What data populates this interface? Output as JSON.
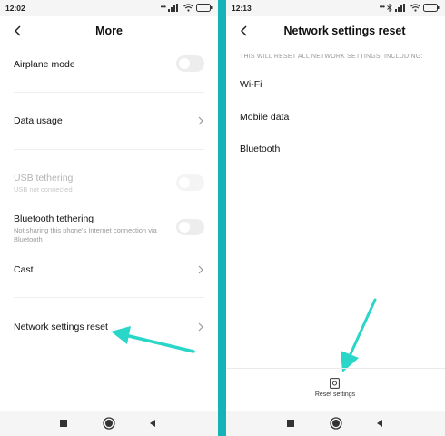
{
  "colors": {
    "accent_arrow": "#2ad6c8",
    "divider": "#14b3b8",
    "disabled_text": "#b5b5b5",
    "secondary_text": "#999999"
  },
  "left": {
    "status_bar": {
      "time": "12:02",
      "icons": [
        "signal-dots-icon",
        "cell-signal-icon",
        "wifi-icon",
        "battery-icon"
      ]
    },
    "header": {
      "title": "More",
      "back_icon": "chevron-left-icon"
    },
    "items": [
      {
        "title": "Airplane mode",
        "control": "toggle",
        "enabled": true
      },
      {
        "title": "Data usage",
        "control": "chevron"
      },
      {
        "title": "USB tethering",
        "subtitle": "USB not connected",
        "control": "toggle",
        "enabled": false
      },
      {
        "title": "Bluetooth tethering",
        "subtitle": "Not sharing this phone's Internet connection via Bluetooth",
        "control": "toggle",
        "enabled": true
      },
      {
        "title": "Cast",
        "control": "chevron"
      },
      {
        "title": "Network settings reset",
        "control": "chevron"
      }
    ]
  },
  "right": {
    "status_bar": {
      "time": "12:13",
      "icons": [
        "signal-dots-icon",
        "bluetooth-icon",
        "cell-signal-icon",
        "wifi-icon",
        "battery-icon"
      ]
    },
    "header": {
      "title": "Network settings reset",
      "back_icon": "chevron-left-icon"
    },
    "caption": "THIS WILL RESET ALL NETWORK SETTINGS, INCLUDING:",
    "items": [
      "Wi-Fi",
      "Mobile data",
      "Bluetooth"
    ],
    "reset_button": {
      "label": "Reset settings",
      "icon": "reset-device-icon"
    }
  },
  "nav_bar": {
    "icons": [
      "recents-square-icon",
      "home-circle-icon",
      "back-triangle-icon"
    ]
  }
}
